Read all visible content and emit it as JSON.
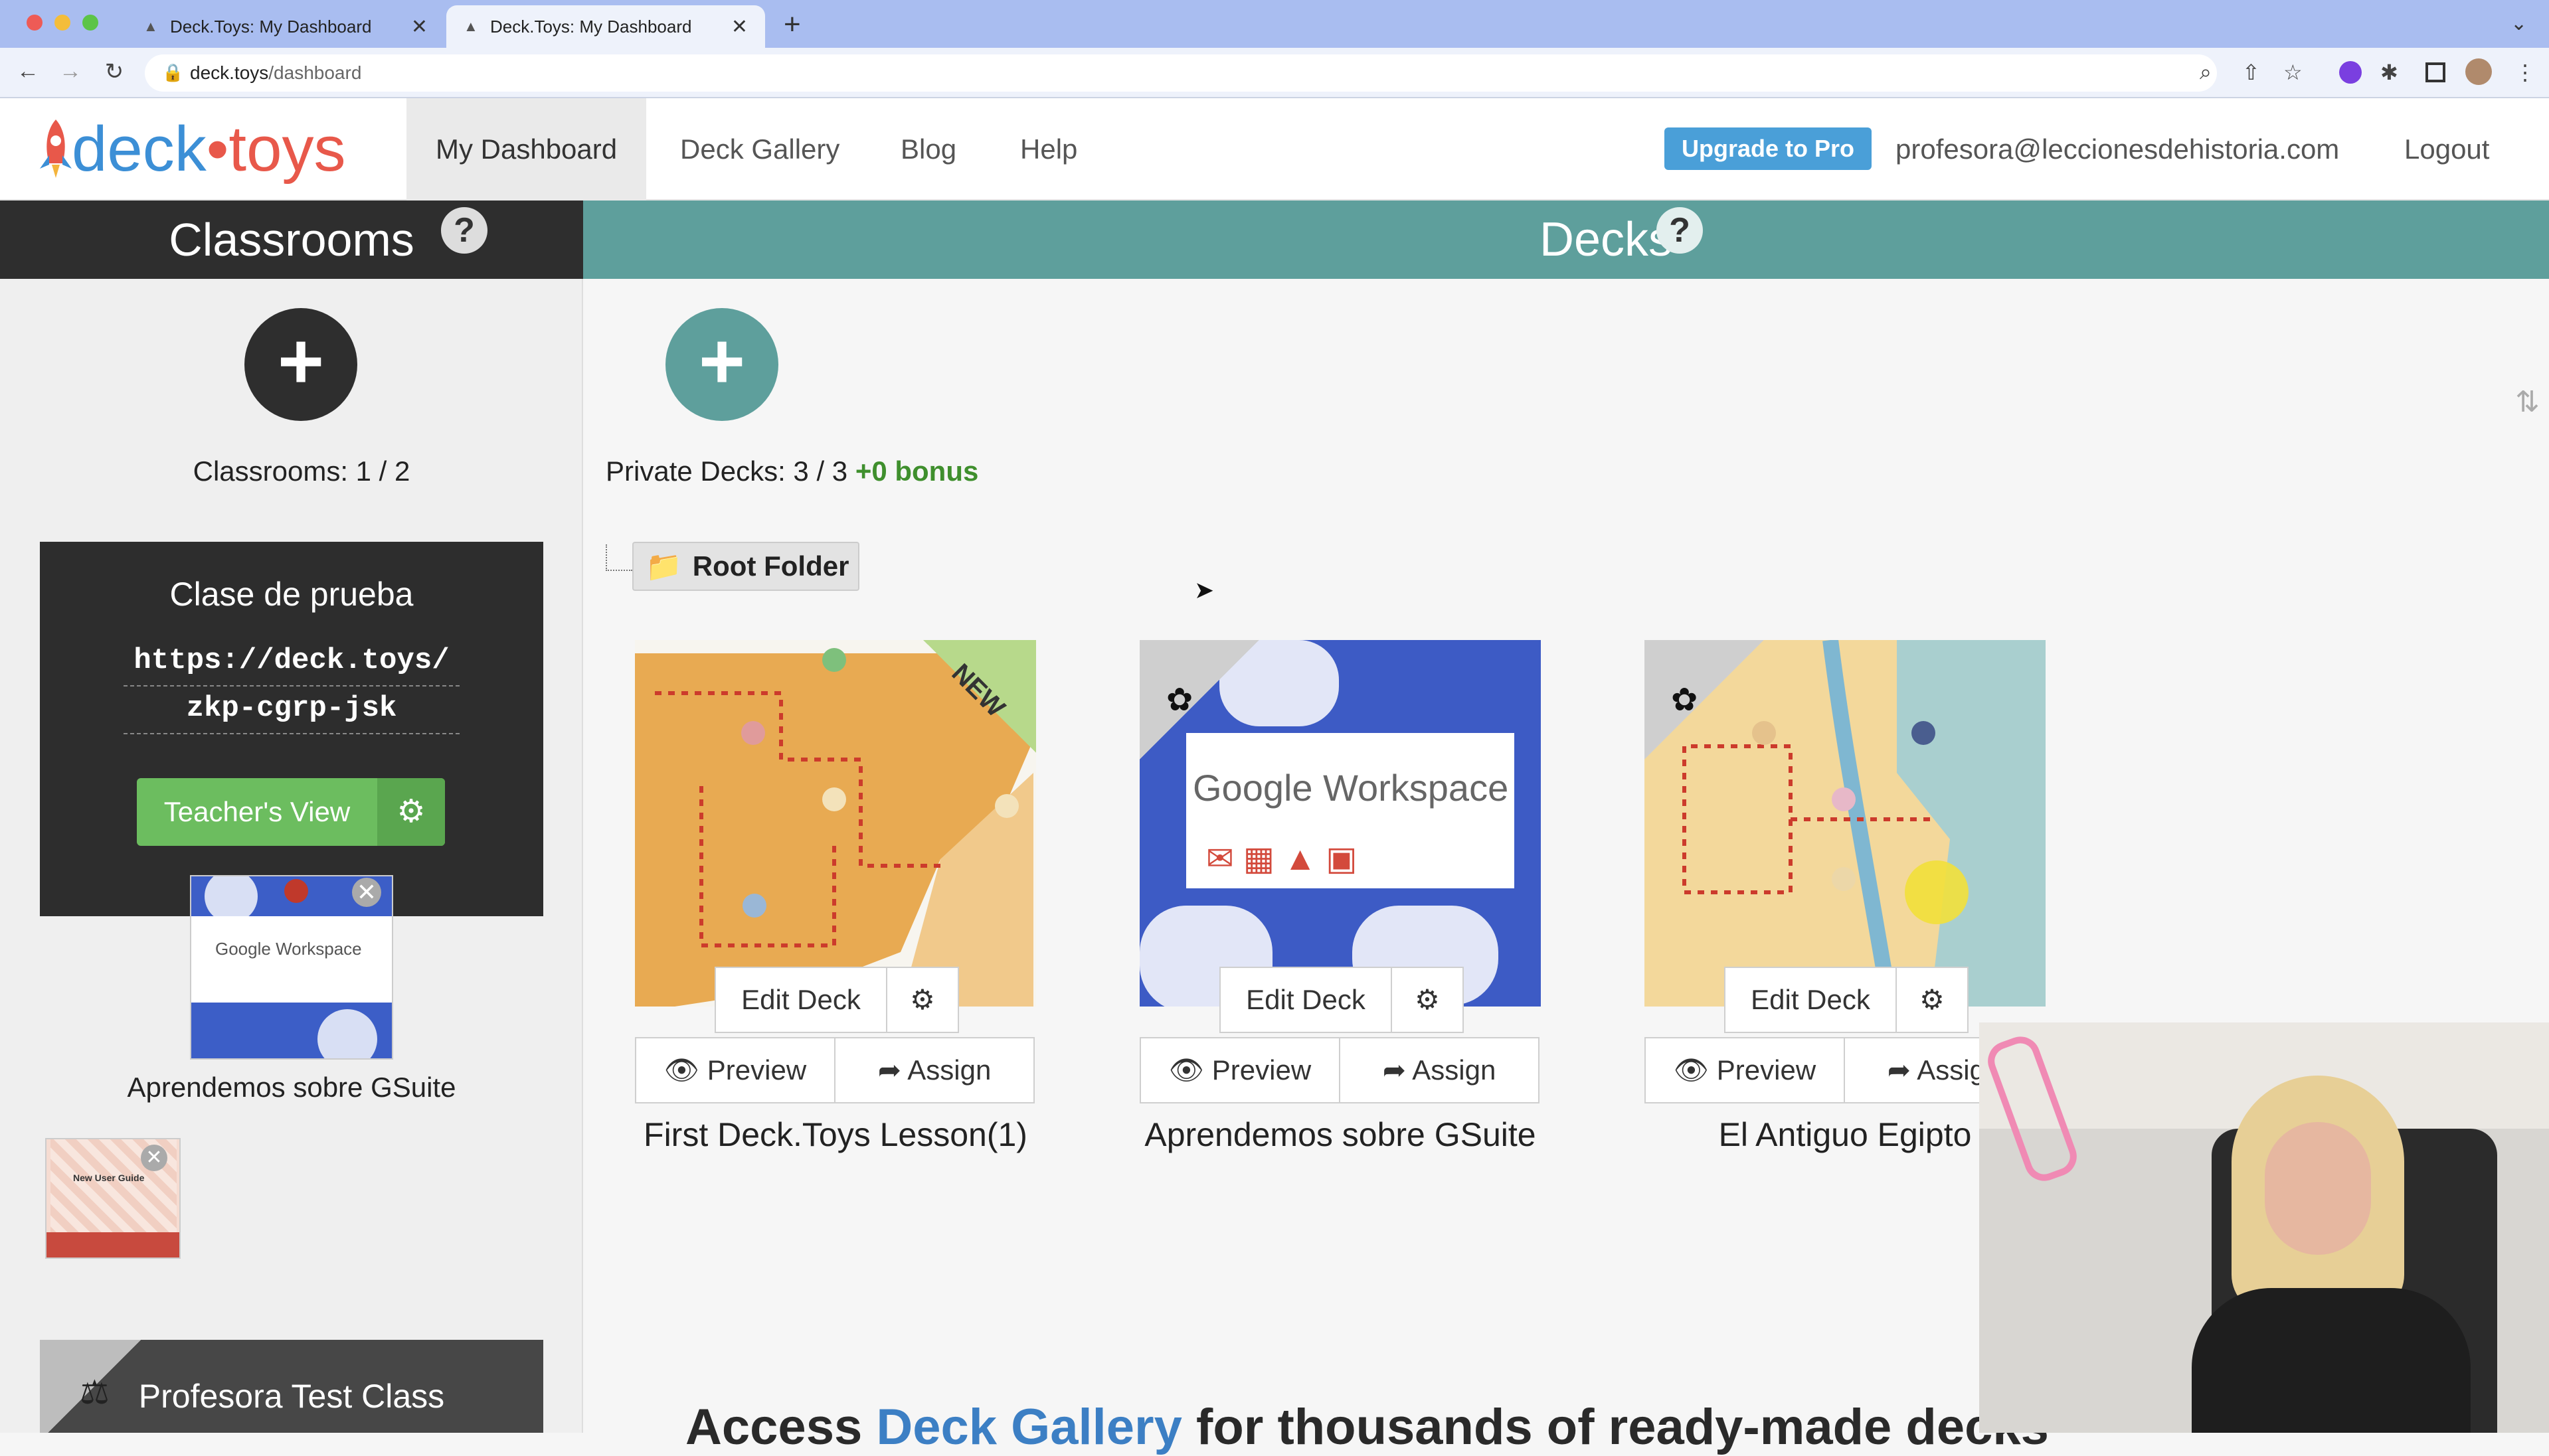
{
  "browser": {
    "tabs": [
      {
        "title": "Deck.Toys: My Dashboard",
        "active": false
      },
      {
        "title": "Deck.Toys: My Dashboard",
        "active": true
      }
    ],
    "url_host": "deck.toys",
    "url_path": "/dashboard"
  },
  "site": {
    "logo_left": "deck",
    "logo_right": "toys",
    "nav": [
      "My Dashboard",
      "Deck Gallery",
      "Blog",
      "Help"
    ],
    "upgrade_label": "Upgrade to Pro",
    "email": "profesora@leccionesdehistoria.com",
    "logout": "Logout"
  },
  "classrooms": {
    "title": "Classrooms",
    "help": "?",
    "count_text": "Classrooms: 1 / 2",
    "card": {
      "name": "Clase de prueba",
      "link_line1": "https://deck.toys/",
      "link_line2": "zkp-cgrp-jsk",
      "teacher_view": "Teacher's View",
      "assigned_deck": "Aprendemos sobre GSuite",
      "guide_text": "New User Guide"
    },
    "second_class": "Profesora Test Class"
  },
  "decks": {
    "title": "Decks",
    "help": "?",
    "private_text": "Private Decks: 3 / 3",
    "bonus_text": "+0 bonus",
    "folder": "Root Folder",
    "edit_label": "Edit Deck",
    "preview_label": "Preview",
    "assign_label": "Assign",
    "items": [
      {
        "name": "First Deck.Toys Lesson(1)",
        "ribbon": "NEW"
      },
      {
        "name": "Aprendemos sobre GSuite",
        "ribbon": ""
      },
      {
        "name": "El Antiguo Egipto",
        "ribbon": ""
      }
    ],
    "gsuite_text": "Google Workspace",
    "gallery_pre": "Access",
    "gallery_link": "Deck Gallery",
    "gallery_post": "for thousands of ready-made decks"
  },
  "colors": {
    "teal": "#5e9f9c",
    "green": "#6cbd5f",
    "blue_button": "#4a9fd8",
    "dark_panel": "#2e2e2e"
  }
}
